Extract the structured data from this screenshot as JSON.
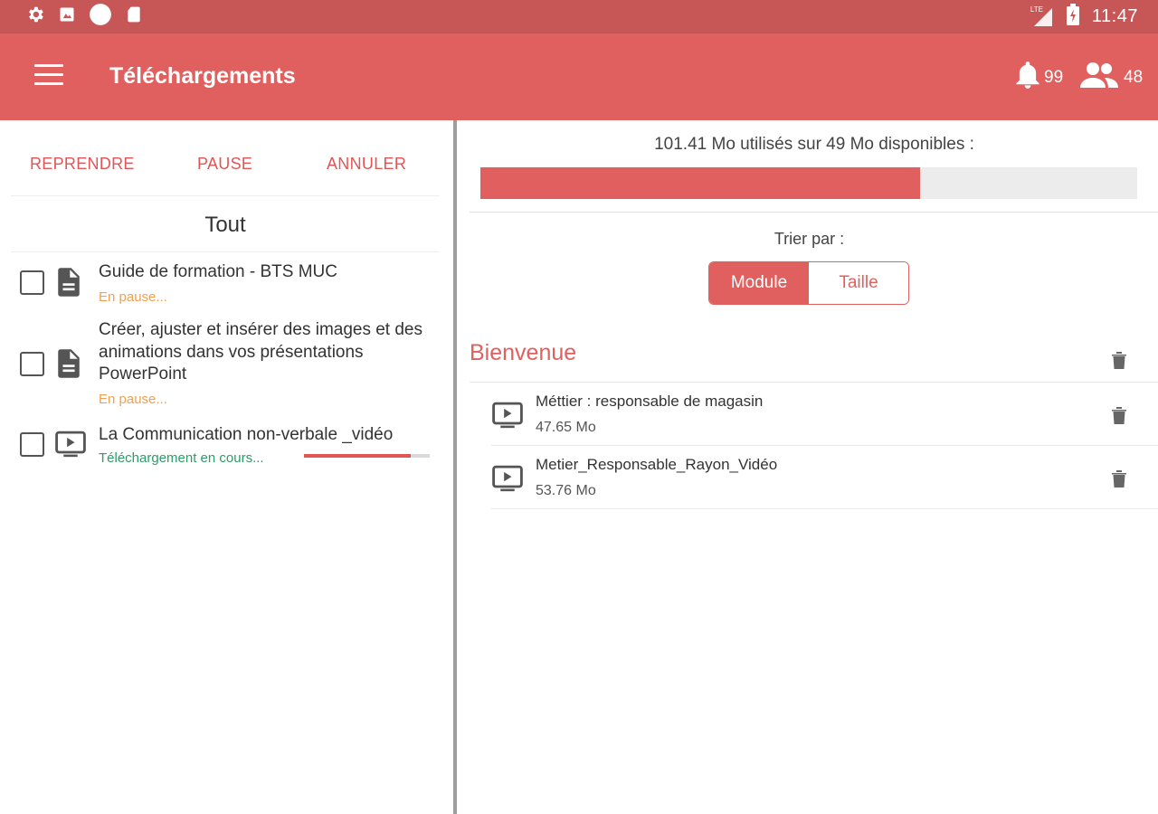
{
  "status_bar": {
    "time": "11:47",
    "network": "LTE"
  },
  "app_bar": {
    "title": "Téléchargements",
    "notifications_count": "99",
    "contacts_count": "48"
  },
  "actions": {
    "resume": "REPRENDRE",
    "pause": "PAUSE",
    "cancel": "ANNULER"
  },
  "filter": {
    "label": "Tout"
  },
  "downloads": [
    {
      "title": "Guide de formation - BTS MUC",
      "status": "En pause...",
      "type_icon": "document-icon"
    },
    {
      "title": "Créer, ajuster et insérer des images et des animations dans vos présentations PowerPoint",
      "status": "En pause...",
      "type_icon": "document-icon"
    },
    {
      "title": "La Communication non-verbale _vidéo",
      "status": "Téléchargement en cours...",
      "type_icon": "video-icon",
      "progress": 0.85
    }
  ],
  "storage": {
    "usage_text": "101.41 Mo utilisés sur 49 Mo disponibles :",
    "used_fraction": 0.67
  },
  "sort": {
    "label": "Trier par :",
    "options": [
      "Module",
      "Taille"
    ],
    "selected": "Module"
  },
  "modules": [
    {
      "name": "Bienvenue",
      "items": [
        {
          "title": "Méttier : responsable de magasin",
          "size": "47.65 Mo"
        },
        {
          "title": "Metier_Responsable_Rayon_Vidéo",
          "size": "53.76 Mo"
        }
      ]
    }
  ],
  "colors": {
    "status_bar": "#c75656",
    "primary": "#e06060",
    "accent_text": "#e05656",
    "paused": "#f0a050",
    "downloading": "#2e9c66"
  }
}
